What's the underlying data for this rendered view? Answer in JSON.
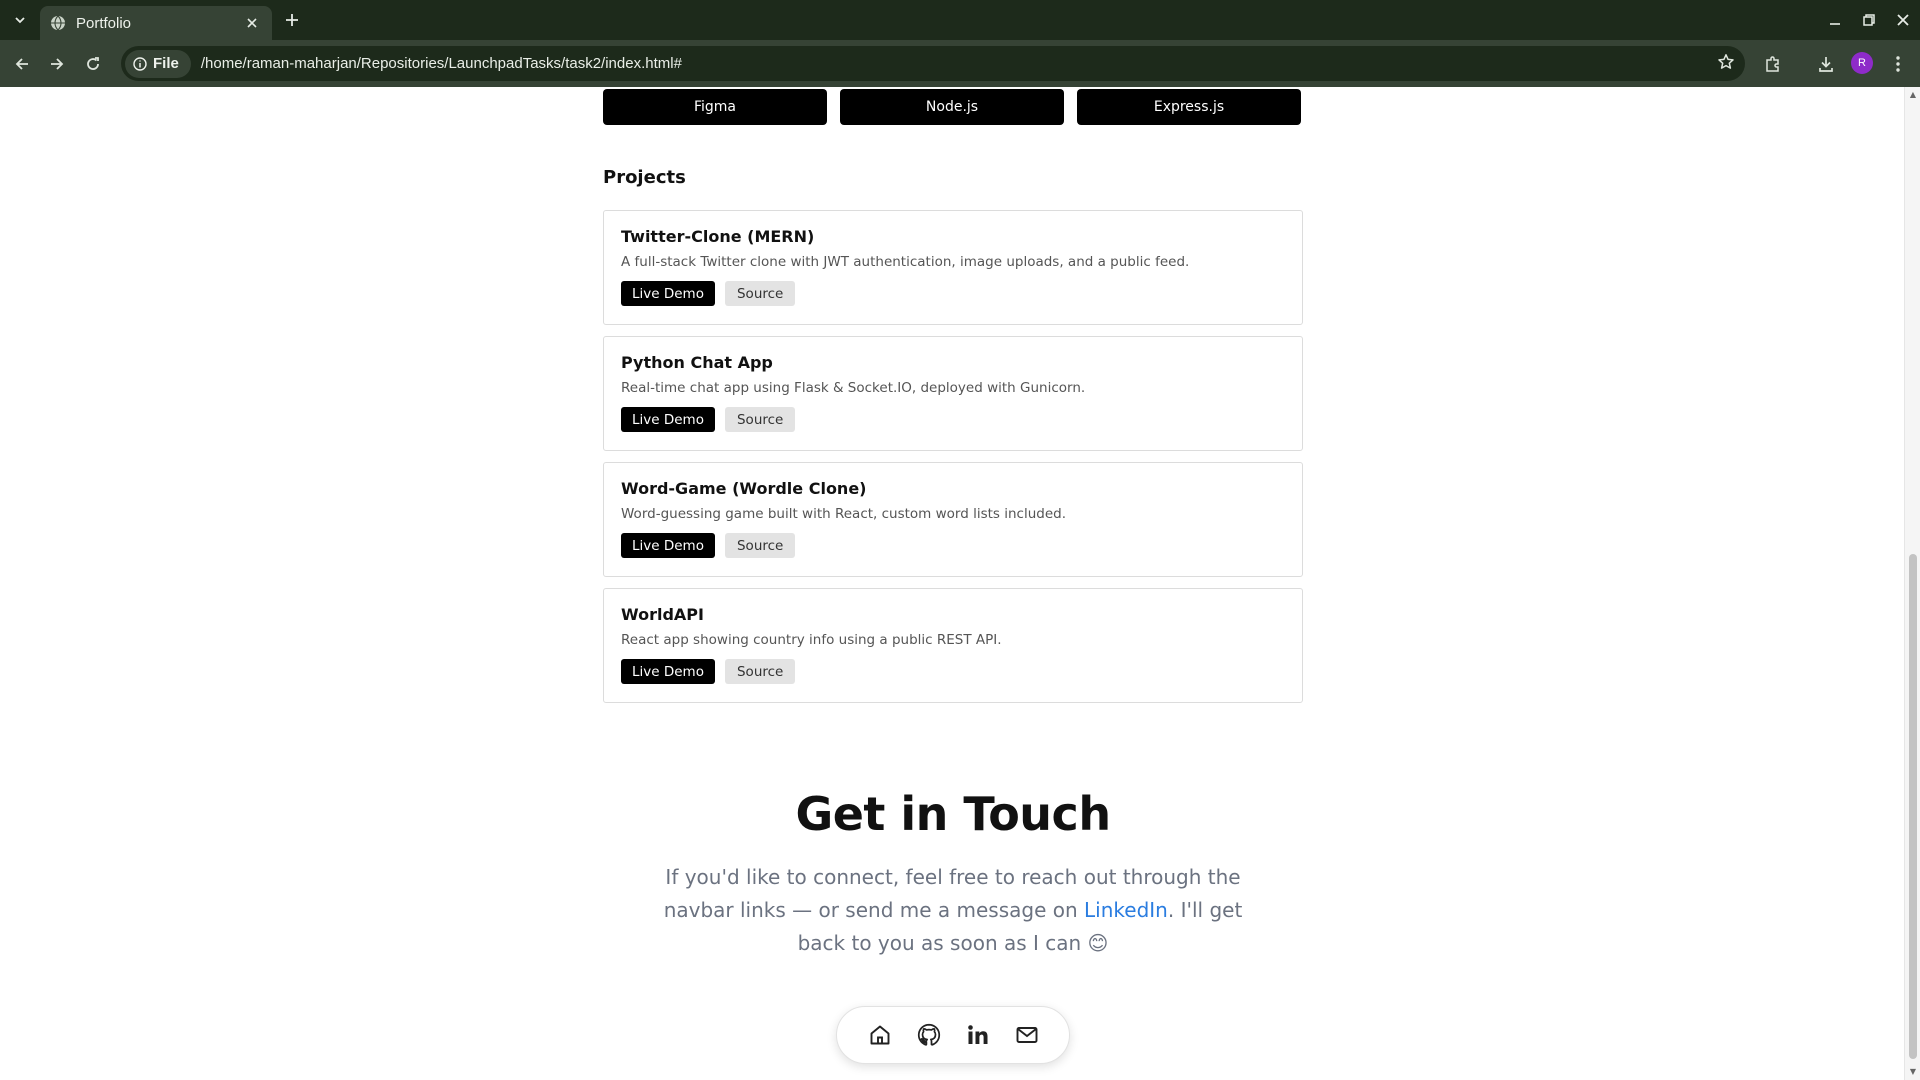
{
  "browser": {
    "tab_title": "Portfolio",
    "site_chip": "File",
    "url": "/home/raman-maharjan/Repositories/LaunchpadTasks/task2/index.html#",
    "profile_initial": "R"
  },
  "skills": [
    "Figma",
    "Node.js",
    "Express.js"
  ],
  "projects_section": {
    "title": "Projects",
    "items": [
      {
        "name": "Twitter-Clone (MERN)",
        "description": "A full-stack Twitter clone with JWT authentication, image uploads, and a public feed.",
        "demo_label": "Live Demo",
        "source_label": "Source"
      },
      {
        "name": "Python Chat App",
        "description": "Real-time chat app using Flask & Socket.IO, deployed with Gunicorn.",
        "demo_label": "Live Demo",
        "source_label": "Source"
      },
      {
        "name": "Word-Game (Wordle Clone)",
        "description": "Word-guessing game built with React, custom word lists included.",
        "demo_label": "Live Demo",
        "source_label": "Source"
      },
      {
        "name": "WorldAPI",
        "description": "React app showing country info using a public REST API.",
        "demo_label": "Live Demo",
        "source_label": "Source"
      }
    ]
  },
  "contact": {
    "title": "Get in Touch",
    "text_before": "If you'd like to connect, feel free to reach out through the navbar links — or send me a message on ",
    "link_label": "LinkedIn",
    "text_after": ". I'll get back to you as soon as I can 😊"
  },
  "dock": {
    "icons": [
      "home-icon",
      "github-icon",
      "linkedin-icon",
      "mail-icon"
    ]
  },
  "colors": {
    "chrome_dark": "#1d2a1b",
    "chrome_mid": "#364335",
    "link": "#2b7de0",
    "button_dark": "#000000"
  }
}
